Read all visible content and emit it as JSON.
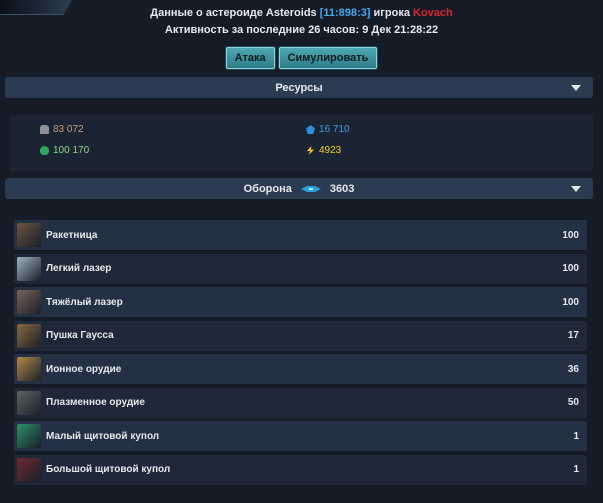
{
  "header": {
    "line1_prefix": "Данные о астероиде Asteroids",
    "coords": "[11:898:3]",
    "line1_mid": "игрока",
    "player": "Kovach",
    "line2": "Активность за последние 26 часов: 9 Дек 21:28:22"
  },
  "buttons": {
    "attack": "Атака",
    "simulate": "Симулировать"
  },
  "resources": {
    "title": "Ресурсы",
    "metal": "83 072",
    "crystal": "16 710",
    "deuterium": "100 170",
    "energy": "4923",
    "icons": [
      "metal-icon",
      "crystal-icon",
      "deuterium-icon",
      "energy-icon"
    ]
  },
  "defense": {
    "title": "Оборона",
    "total": "3603",
    "items": [
      {
        "name": "Ракетница",
        "count": "100",
        "thumb": "#6b5540"
      },
      {
        "name": "Легкий лазер",
        "count": "100",
        "thumb": "#9fb2c0"
      },
      {
        "name": "Тяжёлый лазер",
        "count": "100",
        "thumb": "#7a6258"
      },
      {
        "name": "Пушка Гаусса",
        "count": "17",
        "thumb": "#8a6a3e"
      },
      {
        "name": "Ионное орудие",
        "count": "36",
        "thumb": "#b08a4a"
      },
      {
        "name": "Плазменное орудие",
        "count": "50",
        "thumb": "#5c6660"
      },
      {
        "name": "Малый щитовой купол",
        "count": "1",
        "thumb": "#2f8f6a"
      },
      {
        "name": "Большой щитовой купол",
        "count": "1",
        "thumb": "#6b2b34"
      }
    ]
  },
  "colors": {
    "coords": "#4aa8e8",
    "player": "#d8272c",
    "button": "#3b95a0",
    "bar": "#2c3b51"
  }
}
